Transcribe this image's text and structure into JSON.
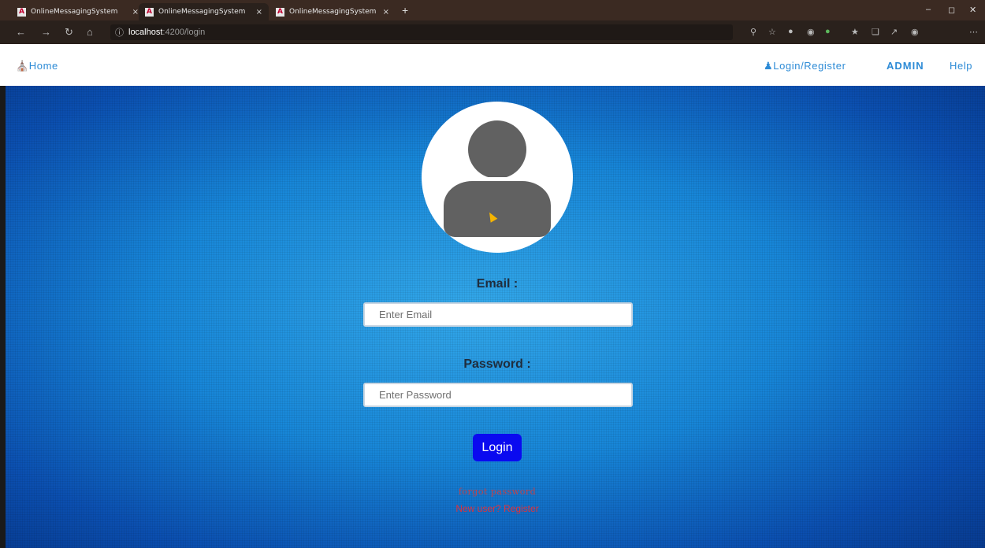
{
  "browser": {
    "tabs": [
      {
        "title": "OnlineMessagingSystem",
        "close": "×"
      },
      {
        "title": "OnlineMessagingSystem",
        "close": "×"
      },
      {
        "title": "OnlineMessagingSystem",
        "close": "×"
      }
    ],
    "tab_logo": "A",
    "new_tab": "+",
    "url": {
      "host": "localhost",
      "path": ":4200/login"
    },
    "window_controls": {
      "minimize": "–",
      "maximize": "◻",
      "close": "✕"
    }
  },
  "navbar": {
    "home": "Home",
    "login_register": "Login/Register",
    "admin": "ADMIN",
    "help": "Help"
  },
  "form": {
    "email_label": "Email :",
    "email_placeholder": "Enter Email",
    "password_label": "Password :",
    "password_placeholder": "Enter Password",
    "login_button": "Login",
    "forgot_password": "forgot password",
    "register_link": "New user? Register"
  },
  "colors": {
    "nav_link": "#2d8bd6",
    "login_button": "#0a0af0",
    "forgot_link": "#c2434b",
    "register_link": "#e2323a"
  }
}
